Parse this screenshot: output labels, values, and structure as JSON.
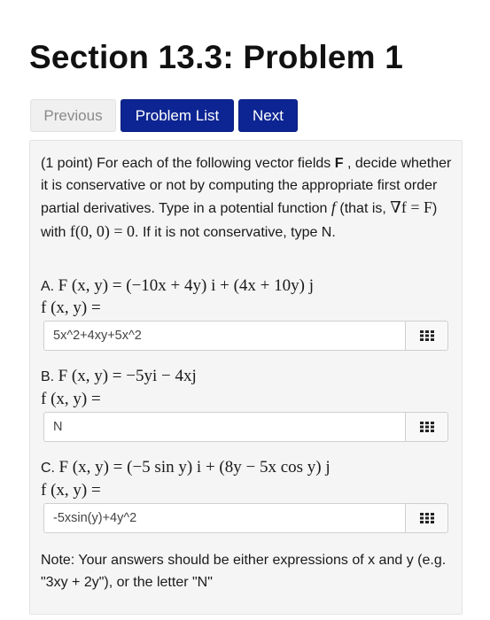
{
  "page": {
    "title": "Section 13.3: Problem 1"
  },
  "nav": {
    "previous": "Previous",
    "problem_list": "Problem List",
    "next": "Next"
  },
  "problem": {
    "points": "(1 point)",
    "intro_1": " For each of the following vector fields ",
    "F": "F",
    "intro_2": " , decide whether it is conservative or not by computing the appropriate first order partial derivatives. Type in a potential function ",
    "f": "f",
    "intro_3": " (that is, ",
    "grad_eq": "∇f = F",
    "intro_4": ") with ",
    "init_cond": "f(0, 0) = 0",
    "intro_5": ". If it is not conservative, type N.",
    "parts": [
      {
        "letter": "A.",
        "field": "F (x, y) = (−10x + 4y) i + (4x + 10y) j",
        "f_label": "f (x, y) =",
        "answer": "5x^2+4xy+5x^2"
      },
      {
        "letter": "B.",
        "field": "F (x, y) = −5yi − 4xj",
        "f_label": "f (x, y) =",
        "answer": "N"
      },
      {
        "letter": "C.",
        "field": "F (x, y) = (−5 sin y) i + (8y − 5x cos y) j",
        "f_label": "f (x, y) =",
        "answer": "-5xsin(y)+4y^2"
      }
    ],
    "note": "Note: Your answers should be either expressions of x and y (e.g. \"3xy + 2y\"), or the letter \"N\""
  },
  "icons": {
    "answer_tool": "grid-icon"
  },
  "colors": {
    "primary_button": "#0d2592",
    "disabled_button": "#f0f0f0",
    "panel": "#f5f5f5"
  }
}
